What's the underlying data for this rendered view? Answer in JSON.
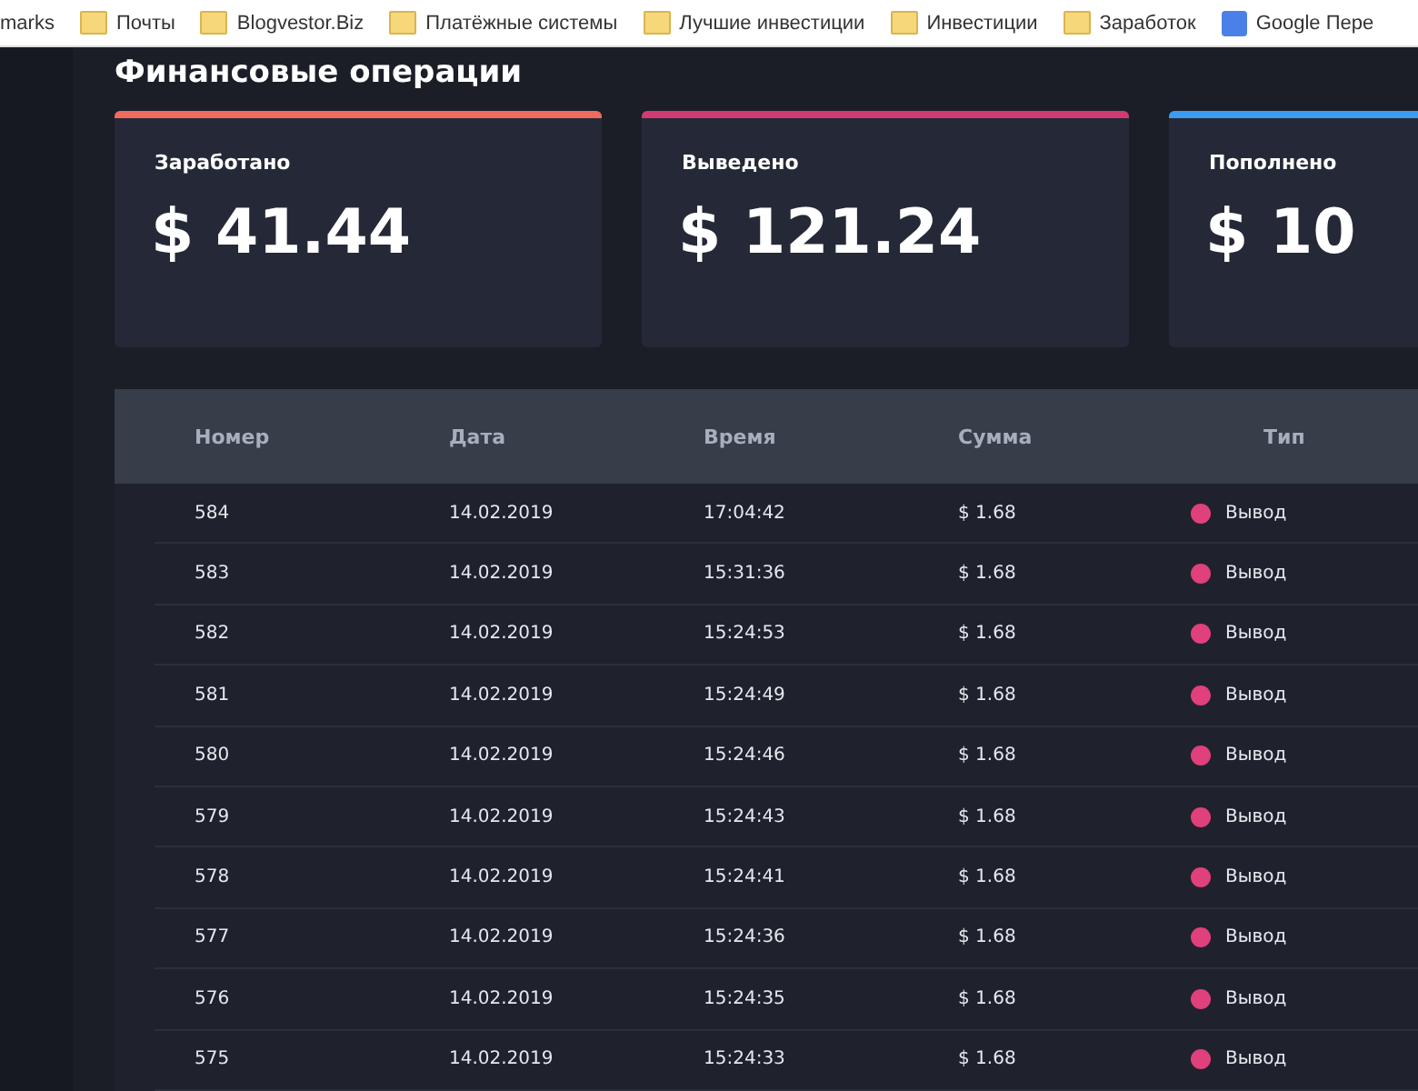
{
  "bookmarks": [
    {
      "label": "marks",
      "kind": "text"
    },
    {
      "label": "Почты",
      "kind": "folder"
    },
    {
      "label": "Blogvestor.Biz",
      "kind": "folder"
    },
    {
      "label": "Платёжные системы",
      "kind": "folder"
    },
    {
      "label": "Лучшие инвестиции",
      "kind": "folder"
    },
    {
      "label": "Инвестиции",
      "kind": "folder"
    },
    {
      "label": "Заработок",
      "kind": "folder"
    },
    {
      "label": "Google Пере",
      "kind": "google"
    }
  ],
  "title": "Финансовые операции",
  "cards": [
    {
      "label": "Заработано",
      "value": "$ 41.44",
      "color": "#f06a5e"
    },
    {
      "label": "Выведено",
      "value": "$ 121.24",
      "color": "#d23a72"
    },
    {
      "label": "Пополнено",
      "value": "$ 10",
      "color": "#3c9cf2"
    }
  ],
  "table": {
    "columns": [
      "Номер",
      "Дата",
      "Время",
      "Сумма",
      "Тип"
    ],
    "rows": [
      {
        "cells": [
          "584",
          "14.02.2019",
          "17:04:42",
          "$ 1.68"
        ],
        "type": "Вывод",
        "color": "#e0407c"
      },
      {
        "cells": [
          "583",
          "14.02.2019",
          "15:31:36",
          "$ 1.68"
        ],
        "type": "Вывод",
        "color": "#e0407c"
      },
      {
        "cells": [
          "582",
          "14.02.2019",
          "15:24:53",
          "$ 1.68"
        ],
        "type": "Вывод",
        "color": "#e0407c"
      },
      {
        "cells": [
          "581",
          "14.02.2019",
          "15:24:49",
          "$ 1.68"
        ],
        "type": "Вывод",
        "color": "#e0407c"
      },
      {
        "cells": [
          "580",
          "14.02.2019",
          "15:24:46",
          "$ 1.68"
        ],
        "type": "Вывод",
        "color": "#e0407c"
      },
      {
        "cells": [
          "579",
          "14.02.2019",
          "15:24:43",
          "$ 1.68"
        ],
        "type": "Вывод",
        "color": "#e0407c"
      },
      {
        "cells": [
          "578",
          "14.02.2019",
          "15:24:41",
          "$ 1.68"
        ],
        "type": "Вывод",
        "color": "#e0407c"
      },
      {
        "cells": [
          "577",
          "14.02.2019",
          "15:24:36",
          "$ 1.68"
        ],
        "type": "Вывод",
        "color": "#e0407c"
      },
      {
        "cells": [
          "576",
          "14.02.2019",
          "15:24:35",
          "$ 1.68"
        ],
        "type": "Вывод",
        "color": "#e0407c"
      },
      {
        "cells": [
          "575",
          "14.02.2019",
          "15:24:33",
          "$ 1.68"
        ],
        "type": "Вывод",
        "color": "#e0407c"
      }
    ]
  }
}
